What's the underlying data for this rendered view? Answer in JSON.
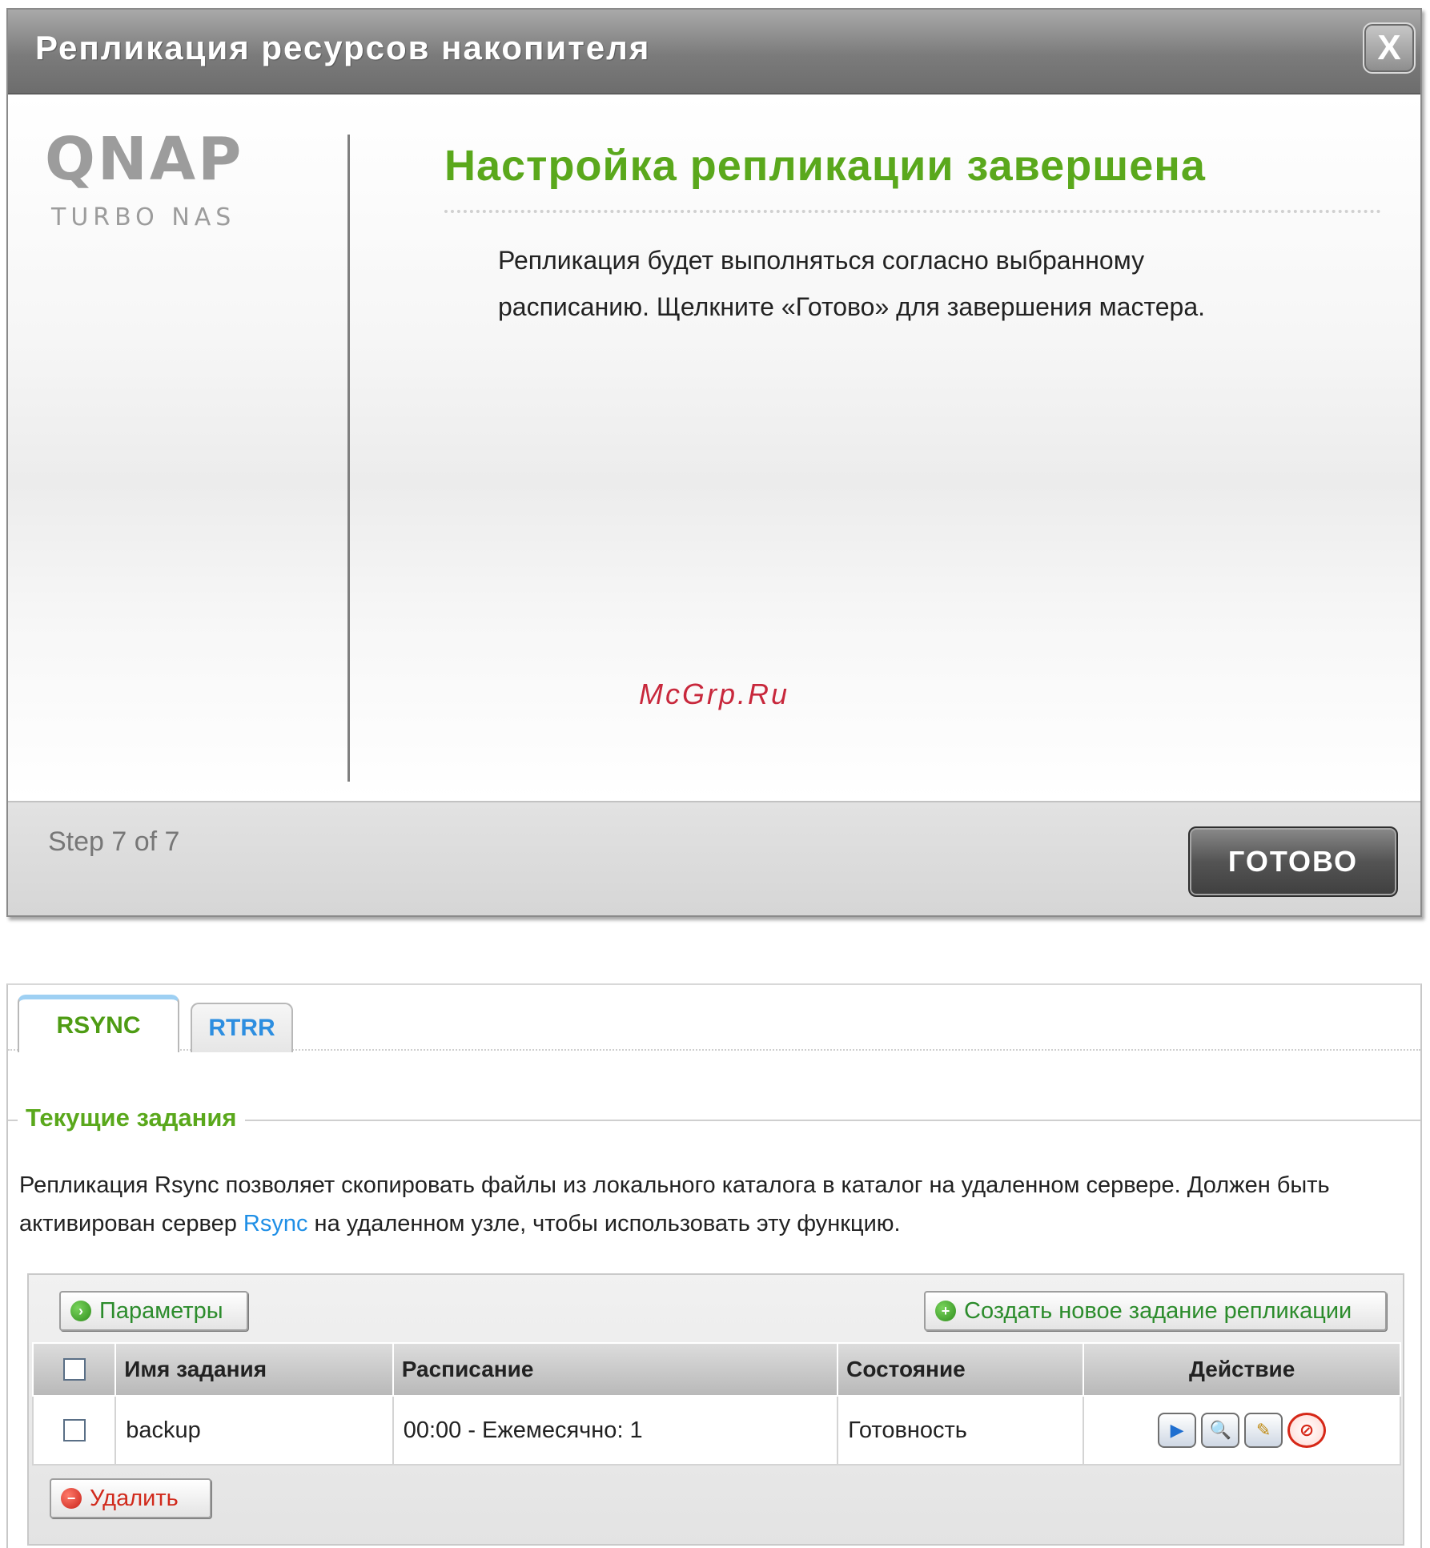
{
  "wizard": {
    "title": "Репликация ресурсов накопителя",
    "close_label": "X",
    "logo_main": "QNAP",
    "logo_sub": "TURBO NAS",
    "heading": "Настройка репликации завершена",
    "message_line1": "Репликация будет выполняться согласно выбранному",
    "message_line2": "расписанию. Щелкните «Готово» для завершения мастера.",
    "step_text": "Step 7 of 7",
    "done_label": "ГОТОВО",
    "heading_color": "#5aa81c"
  },
  "watermark": "McGrp.Ru",
  "panel": {
    "tabs": [
      {
        "label": "RSYNC",
        "active": true
      },
      {
        "label": "RTRR",
        "active": false
      }
    ],
    "section_title": "Текущие задания",
    "description_pre": "Репликация Rsync позволяет скопировать файлы из локального каталога в каталог на удаленном сервере. Должен быть активирован сервер ",
    "description_link": "Rsync",
    "description_post": " на удаленном узле, чтобы использовать эту функцию.",
    "params_button": "Параметры",
    "create_button": "Создать новое задание репликации",
    "delete_button": "Удалить",
    "table": {
      "headers": [
        "Имя задания",
        "Расписание",
        "Состояние",
        "Действие"
      ],
      "rows": [
        {
          "name": "backup",
          "schedule": "00:00 - Ежемесячно: 1",
          "status": "Готовность"
        }
      ]
    },
    "action_icons": [
      "play-icon",
      "view-log-icon",
      "edit-icon",
      "stop-icon"
    ]
  }
}
